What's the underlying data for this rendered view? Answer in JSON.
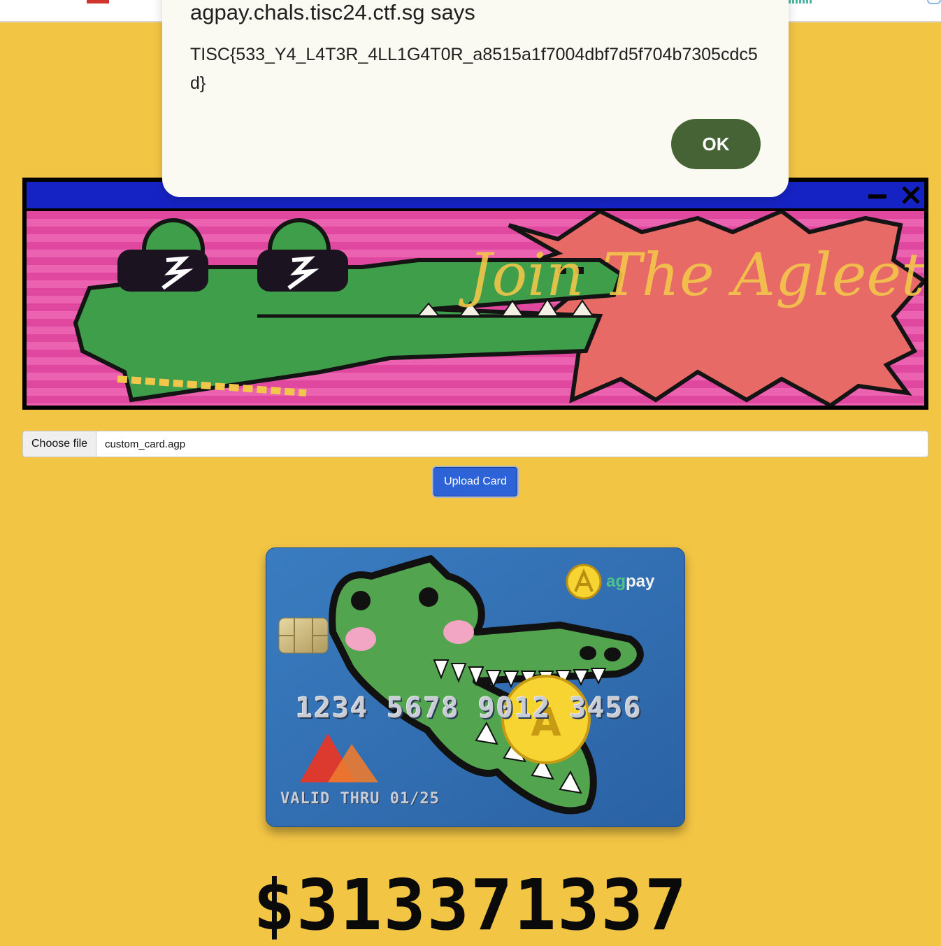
{
  "dialog": {
    "title": "agpay.chals.tisc24.ctf.sg says",
    "message": "TISC{533_Y4_L4T3R_4LL1G4T0R_a8515a1f7004dbf7d5f704b7305cdc5d}",
    "ok_label": "OK"
  },
  "banner": {
    "text": "Join The Agleets",
    "colors": {
      "titlebar": "#1623c4",
      "background": "#e0489f",
      "burst": "#e86a66",
      "text": "#f2c64a",
      "croc": "#3f9e4a"
    }
  },
  "upload": {
    "choose_label": "Choose file",
    "file_name": "custom_card.agp",
    "upload_label": "Upload Card"
  },
  "card": {
    "brand_prefix": "ag",
    "brand_suffix": "pay",
    "number": "1234 5678 9012 3456",
    "valid_thru": "VALID THRU 01/25"
  },
  "balance": "$313371337",
  "colors": {
    "page_bg": "#f3c545",
    "upload_button": "#2d63d6",
    "ok_button": "#466335",
    "card_bg": "#2f6db0"
  }
}
